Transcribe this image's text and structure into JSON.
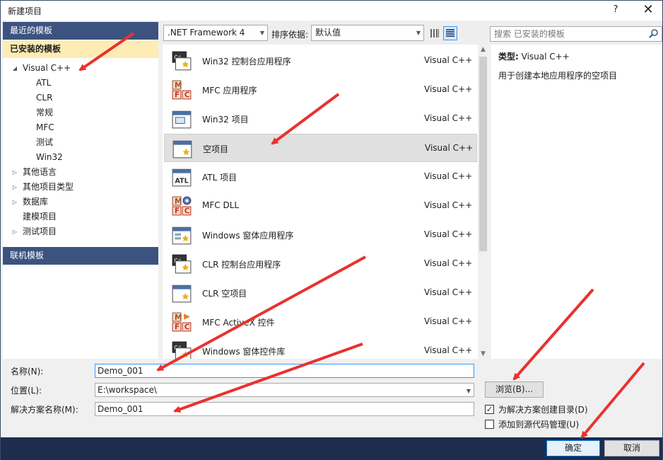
{
  "title": "新建项目",
  "help_label": "?",
  "close_label": "✕",
  "left": {
    "recent_label": "最近的模板",
    "installed_label": "已安装的模板",
    "tree": [
      {
        "label": "Visual C++",
        "level": 0,
        "expanded": true
      },
      {
        "label": "ATL",
        "level": 1
      },
      {
        "label": "CLR",
        "level": 1
      },
      {
        "label": "常规",
        "level": 1
      },
      {
        "label": "MFC",
        "level": 1
      },
      {
        "label": "测试",
        "level": 1
      },
      {
        "label": "Win32",
        "level": 1
      },
      {
        "label": "其他语言",
        "level": 0,
        "expanded": false
      },
      {
        "label": "其他项目类型",
        "level": 0,
        "expanded": false
      },
      {
        "label": "数据库",
        "level": 0,
        "expanded": false
      },
      {
        "label": "建模项目",
        "level": 0
      },
      {
        "label": "测试项目",
        "level": 0,
        "expanded": false
      }
    ],
    "online_label": "联机模板"
  },
  "toolbar": {
    "framework": ".NET Framework 4",
    "sort_label": "排序依据:",
    "sort_value": "默认值",
    "search_placeholder": "搜索 已安装的模板"
  },
  "templates": [
    {
      "name": "Win32 控制台应用程序",
      "lang": "Visual C++",
      "icon": "console-app-icon"
    },
    {
      "name": "MFC 应用程序",
      "lang": "Visual C++",
      "icon": "mfc-icon"
    },
    {
      "name": "Win32 项目",
      "lang": "Visual C++",
      "icon": "window-icon"
    },
    {
      "name": "空项目",
      "lang": "Visual C++",
      "icon": "empty-project-icon",
      "selected": true
    },
    {
      "name": "ATL 项目",
      "lang": "Visual C++",
      "icon": "atl-icon"
    },
    {
      "name": "MFC DLL",
      "lang": "Visual C++",
      "icon": "mfc-dll-icon"
    },
    {
      "name": "Windows 窗体应用程序",
      "lang": "Visual C++",
      "icon": "forms-app-icon"
    },
    {
      "name": "CLR 控制台应用程序",
      "lang": "Visual C++",
      "icon": "console-app-icon"
    },
    {
      "name": "CLR 空项目",
      "lang": "Visual C++",
      "icon": "empty-project-icon"
    },
    {
      "name": "MFC ActiveX 控件",
      "lang": "Visual C++",
      "icon": "mfc-activex-icon"
    },
    {
      "name": "Windows 窗体控件库",
      "lang": "Visual C++",
      "icon": "console-app-icon"
    }
  ],
  "description": {
    "type_label": "类型:",
    "type_value": "Visual C++",
    "text": "用于创建本地应用程序的空项目"
  },
  "form": {
    "name_label": "名称(N):",
    "name_value": "Demo_001",
    "location_label": "位置(L):",
    "location_value": "E:\\workspace\\",
    "solution_label": "解决方案名称(M):",
    "solution_value": "Demo_001",
    "browse_label": "浏览(B)...",
    "create_dir_label": "为解决方案创建目录(D)",
    "create_dir_checked": true,
    "source_control_label": "添加到源代码管理(U)",
    "source_control_checked": false
  },
  "footer": {
    "ok_label": "确定",
    "cancel_label": "取消"
  },
  "colors": {
    "header_blue": "#3c5380",
    "selected_yellow": "#fdecb4",
    "annotation_red": "#e8322f"
  }
}
